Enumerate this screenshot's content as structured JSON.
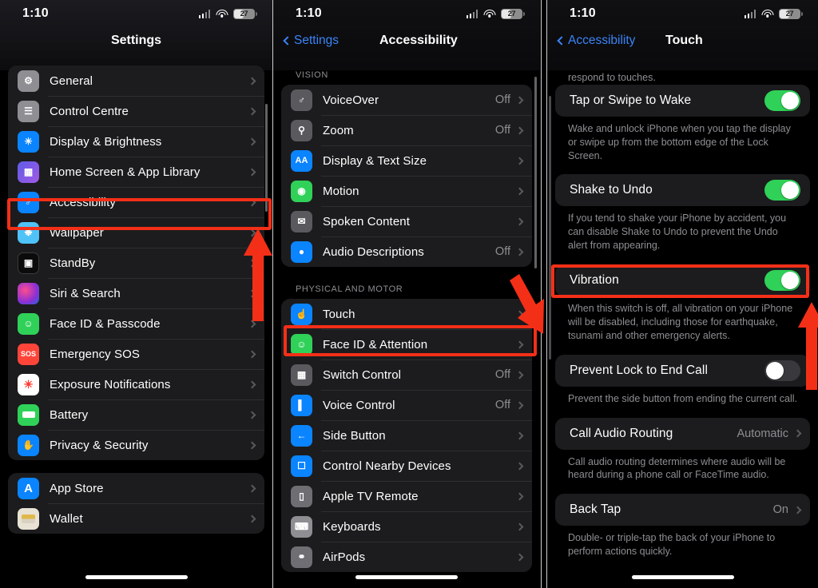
{
  "status_bar": {
    "time": "1:10",
    "battery_level": "27"
  },
  "panel1": {
    "nav_title": "Settings",
    "groups": [
      {
        "items": [
          {
            "label": "General",
            "icon": "gear-icon",
            "value": "",
            "chevron": true
          },
          {
            "label": "Control Centre",
            "icon": "control-centre-icon",
            "value": "",
            "chevron": true
          },
          {
            "label": "Display & Brightness",
            "icon": "brightness-icon",
            "value": "",
            "chevron": true
          },
          {
            "label": "Home Screen & App Library",
            "icon": "home-screen-icon",
            "value": "",
            "chevron": true
          },
          {
            "label": "Accessibility",
            "icon": "accessibility-icon",
            "value": "",
            "chevron": true,
            "highlighted": true
          },
          {
            "label": "Wallpaper",
            "icon": "wallpaper-icon",
            "value": "",
            "chevron": true
          },
          {
            "label": "StandBy",
            "icon": "standby-icon",
            "value": "",
            "chevron": true
          },
          {
            "label": "Siri & Search",
            "icon": "siri-icon",
            "value": "",
            "chevron": true
          },
          {
            "label": "Face ID & Passcode",
            "icon": "face-id-icon",
            "value": "",
            "chevron": true
          },
          {
            "label": "Emergency SOS",
            "icon": "sos-icon",
            "value": "",
            "chevron": true
          },
          {
            "label": "Exposure Notifications",
            "icon": "exposure-icon",
            "value": "",
            "chevron": true
          },
          {
            "label": "Battery",
            "icon": "battery-icon",
            "value": "",
            "chevron": true
          },
          {
            "label": "Privacy & Security",
            "icon": "privacy-icon",
            "value": "",
            "chevron": true
          }
        ]
      },
      {
        "items": [
          {
            "label": "App Store",
            "icon": "app-store-icon",
            "value": "",
            "chevron": true
          },
          {
            "label": "Wallet",
            "icon": "wallet-icon",
            "value": "",
            "chevron": true
          }
        ]
      }
    ]
  },
  "panel2": {
    "nav_back": "Settings",
    "nav_title": "Accessibility",
    "section_vision": "VISION",
    "section_physical": "PHYSICAL AND MOTOR",
    "vision_items": [
      {
        "label": "VoiceOver",
        "icon": "voiceover-icon",
        "value": "Off",
        "chevron": true
      },
      {
        "label": "Zoom",
        "icon": "zoom-icon",
        "value": "Off",
        "chevron": true
      },
      {
        "label": "Display & Text Size",
        "icon": "display-text-size-icon",
        "value": "",
        "chevron": true
      },
      {
        "label": "Motion",
        "icon": "motion-icon",
        "value": "",
        "chevron": true
      },
      {
        "label": "Spoken Content",
        "icon": "spoken-content-icon",
        "value": "",
        "chevron": true
      },
      {
        "label": "Audio Descriptions",
        "icon": "audio-descriptions-icon",
        "value": "Off",
        "chevron": true
      }
    ],
    "physical_items": [
      {
        "label": "Touch",
        "icon": "touch-icon",
        "value": "",
        "chevron": true,
        "highlighted": true
      },
      {
        "label": "Face ID & Attention",
        "icon": "face-id-attention-icon",
        "value": "",
        "chevron": true
      },
      {
        "label": "Switch Control",
        "icon": "switch-control-icon",
        "value": "Off",
        "chevron": true
      },
      {
        "label": "Voice Control",
        "icon": "voice-control-icon",
        "value": "Off",
        "chevron": true
      },
      {
        "label": "Side Button",
        "icon": "side-button-icon",
        "value": "",
        "chevron": true
      },
      {
        "label": "Control Nearby Devices",
        "icon": "control-nearby-devices-icon",
        "value": "",
        "chevron": true
      },
      {
        "label": "Apple TV Remote",
        "icon": "apple-tv-remote-icon",
        "value": "",
        "chevron": true
      },
      {
        "label": "Keyboards",
        "icon": "keyboards-icon",
        "value": "",
        "chevron": true
      },
      {
        "label": "AirPods",
        "icon": "airpods-icon",
        "value": "",
        "chevron": true
      }
    ]
  },
  "panel3": {
    "nav_back": "Accessibility",
    "nav_title": "Touch",
    "intro_note": "following settings to change how the screen will respond to touches.",
    "rows": [
      {
        "label": "Tap or Swipe to Wake",
        "control": "toggle",
        "state": "on",
        "note": "Wake and unlock iPhone when you tap the display or swipe up from the bottom edge of the Lock Screen."
      },
      {
        "label": "Shake to Undo",
        "control": "toggle",
        "state": "on",
        "note": "If you tend to shake your iPhone by accident, you can disable Shake to Undo to prevent the Undo alert from appearing."
      },
      {
        "label": "Vibration",
        "control": "toggle",
        "state": "on",
        "highlighted": true,
        "note": "When this switch is off, all vibration on your iPhone will be disabled, including those for earthquake, tsunami and other emergency alerts."
      },
      {
        "label": "Prevent Lock to End Call",
        "control": "toggle",
        "state": "off",
        "note": "Prevent the side button from ending the current call."
      },
      {
        "label": "Call Audio Routing",
        "control": "value",
        "value": "Automatic",
        "note": "Call audio routing determines where audio will be heard during a phone call or FaceTime audio."
      },
      {
        "label": "Back Tap",
        "control": "value",
        "value": "On",
        "note": "Double- or triple-tap the back of your iPhone to perform actions quickly."
      }
    ]
  },
  "annotations": {
    "highlight_color": "#f42f18",
    "arrow_color": "#f42f18",
    "arrows": [
      {
        "name": "arrow-to-accessibility",
        "direction": "up"
      },
      {
        "name": "arrow-to-touch",
        "direction": "down"
      },
      {
        "name": "arrow-to-vibration",
        "direction": "up"
      }
    ]
  }
}
